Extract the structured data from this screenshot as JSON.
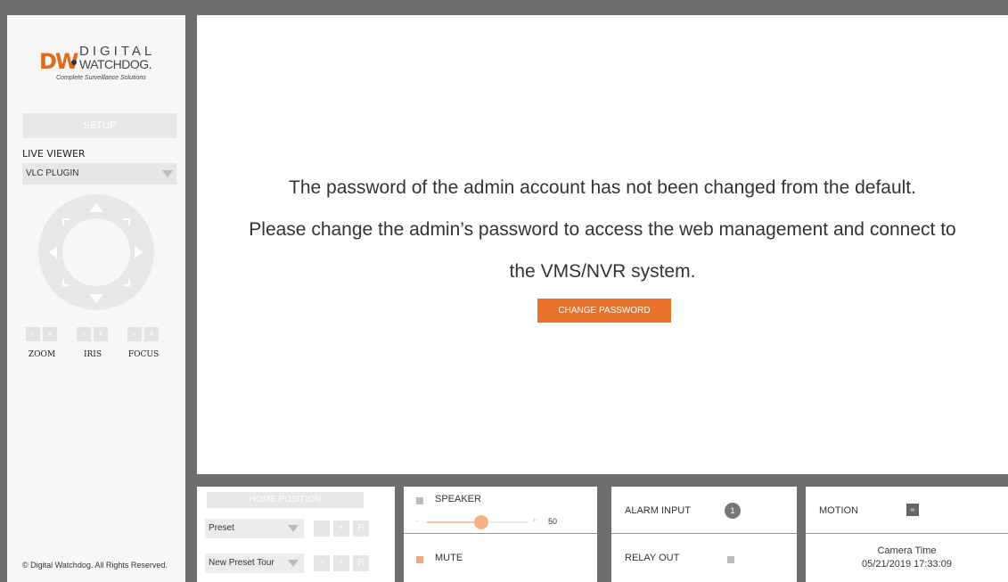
{
  "brand": {
    "dw": "DW",
    "name_top": "DIGITAL",
    "name_bottom": "WATCHDOG.",
    "tagline": "Complete Surveillance Solutions"
  },
  "sidebar": {
    "setup_label": "SETUP",
    "live_viewer_label": "LIVE VIEWER",
    "live_viewer_value": "VLC PLUGIN",
    "lens": [
      {
        "minus": "-",
        "plus": "+",
        "label": "ZOOM"
      },
      {
        "minus": "-",
        "plus": "+",
        "label": "IRIS"
      },
      {
        "minus": "-",
        "plus": "+",
        "label": "FOCUS"
      }
    ],
    "copyright": "© Digital Watchdog. All Rights Reserved."
  },
  "main": {
    "message_line1": "The password of the admin account has not been changed from the default.",
    "message_line2": "Please change the admin’s password to access the web management and connect to",
    "message_line3": "the VMS/NVR system.",
    "change_password_label": "CHANGE PASSWORD"
  },
  "bottom": {
    "home_position_label": "HOME POSITION",
    "preset_value": "Preset",
    "preset_tour_value": "New Preset Tour",
    "mini_minus": "-",
    "mini_plus": "+",
    "mini_r": "R",
    "speaker_label": "SPEAKER",
    "speaker_minus": "-",
    "speaker_plus": "+",
    "speaker_volume": "50",
    "mute_label": "MUTE",
    "alarm_input_label": "ALARM INPUT",
    "alarm_input_count": "1",
    "relay_out_label": "RELAY OUT",
    "motion_label": "MOTION",
    "camera_time_label": "Camera Time",
    "camera_time_value": "05/21/2019 17:33:09"
  },
  "colors": {
    "accent": "#e8722a",
    "frame": "#6e6e6e"
  },
  "icons": {
    "motion": "running-person-icon",
    "ptz": "ptz-direction-pad-icon"
  }
}
